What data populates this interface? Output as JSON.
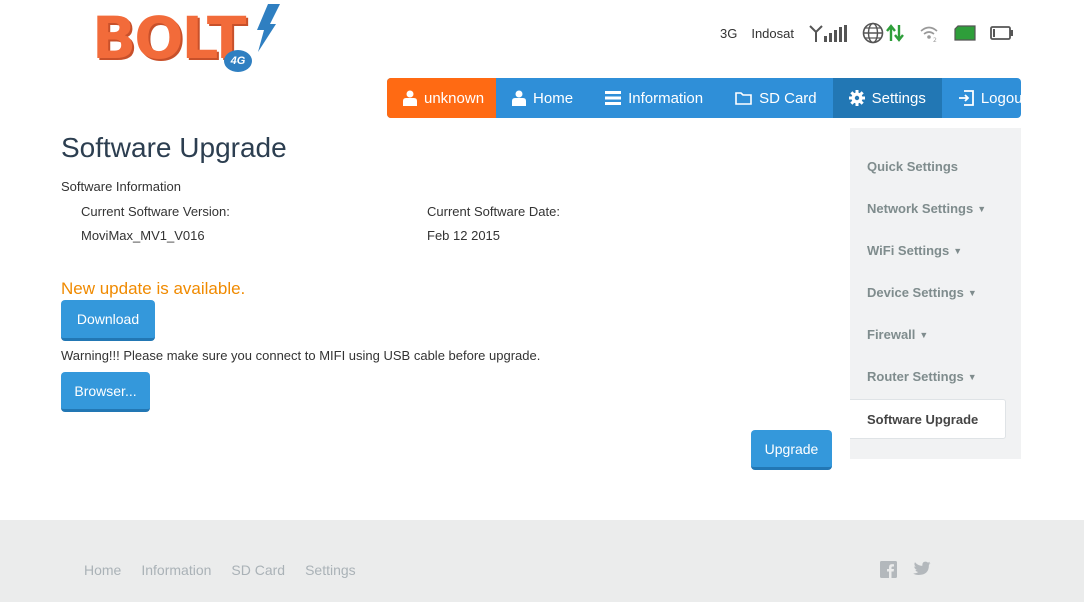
{
  "logo": {
    "text": "bolt",
    "badge": "4G"
  },
  "status": {
    "network_type": "3G",
    "carrier": "Indosat",
    "icons": [
      "signal-icon",
      "globe-icon",
      "data-arrows-icon",
      "wifi-icon",
      "sim-icon",
      "battery-icon"
    ]
  },
  "nav": {
    "user": "unknown",
    "home": "Home",
    "information": "Information",
    "sd_card": "SD Card",
    "settings": "Settings",
    "logout": "Logout"
  },
  "main": {
    "title": "Software Upgrade",
    "section_label": "Software Information",
    "current_version_label": "Current Software Version:",
    "current_version_value": "MoviMax_MV1_V016",
    "current_date_label": "Current Software Date:",
    "current_date_value": "Feb 12 2015",
    "update_message": "New update is available.",
    "download_label": "Download",
    "warning": "Warning!!! Please make sure you connect to MIFI using USB cable before upgrade.",
    "browse_label": "Browser...",
    "upgrade_label": "Upgrade"
  },
  "side_menu": {
    "items": [
      {
        "label": "Quick Settings",
        "has_caret": false
      },
      {
        "label": "Network Settings",
        "has_caret": true
      },
      {
        "label": "WiFi Settings",
        "has_caret": true
      },
      {
        "label": "Device Settings",
        "has_caret": true
      },
      {
        "label": "Firewall",
        "has_caret": true
      },
      {
        "label": "Router Settings",
        "has_caret": true
      }
    ],
    "active": "Software Upgrade"
  },
  "footer": {
    "links": [
      "Home",
      "Information",
      "SD Card",
      "Settings"
    ],
    "social": [
      "facebook-icon",
      "twitter-icon"
    ]
  },
  "colors": {
    "nav_blue": "#2f8fd8",
    "nav_active": "#2277b4",
    "user_orange": "#ff6a13",
    "update_orange": "#f08a00",
    "button_blue": "#3498db"
  }
}
